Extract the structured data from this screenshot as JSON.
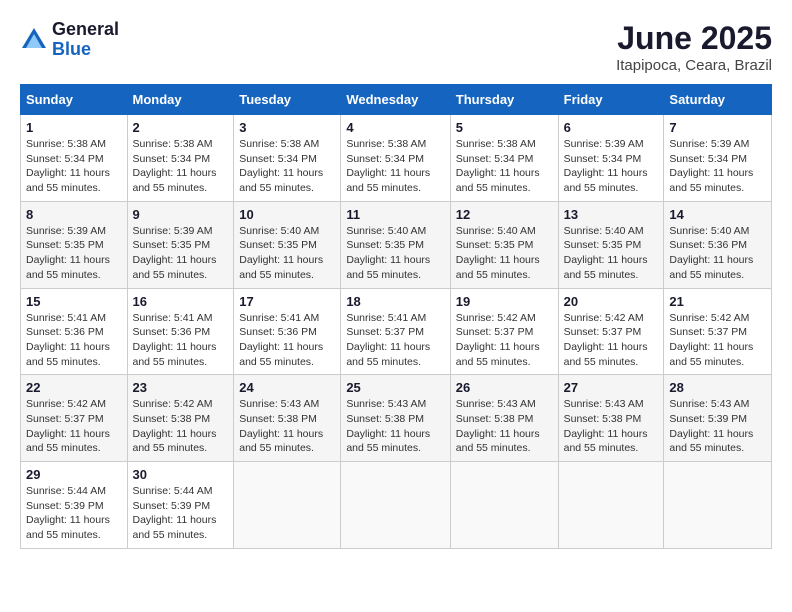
{
  "logo": {
    "general": "General",
    "blue": "Blue"
  },
  "header": {
    "month": "June 2025",
    "location": "Itapipoca, Ceara, Brazil"
  },
  "days_of_week": [
    "Sunday",
    "Monday",
    "Tuesday",
    "Wednesday",
    "Thursday",
    "Friday",
    "Saturday"
  ],
  "weeks": [
    [
      {
        "day": 1,
        "sunrise": "5:38 AM",
        "sunset": "5:34 PM",
        "daylight": "11 hours and 55 minutes."
      },
      {
        "day": 2,
        "sunrise": "5:38 AM",
        "sunset": "5:34 PM",
        "daylight": "11 hours and 55 minutes."
      },
      {
        "day": 3,
        "sunrise": "5:38 AM",
        "sunset": "5:34 PM",
        "daylight": "11 hours and 55 minutes."
      },
      {
        "day": 4,
        "sunrise": "5:38 AM",
        "sunset": "5:34 PM",
        "daylight": "11 hours and 55 minutes."
      },
      {
        "day": 5,
        "sunrise": "5:38 AM",
        "sunset": "5:34 PM",
        "daylight": "11 hours and 55 minutes."
      },
      {
        "day": 6,
        "sunrise": "5:39 AM",
        "sunset": "5:34 PM",
        "daylight": "11 hours and 55 minutes."
      },
      {
        "day": 7,
        "sunrise": "5:39 AM",
        "sunset": "5:34 PM",
        "daylight": "11 hours and 55 minutes."
      }
    ],
    [
      {
        "day": 8,
        "sunrise": "5:39 AM",
        "sunset": "5:35 PM",
        "daylight": "11 hours and 55 minutes."
      },
      {
        "day": 9,
        "sunrise": "5:39 AM",
        "sunset": "5:35 PM",
        "daylight": "11 hours and 55 minutes."
      },
      {
        "day": 10,
        "sunrise": "5:40 AM",
        "sunset": "5:35 PM",
        "daylight": "11 hours and 55 minutes."
      },
      {
        "day": 11,
        "sunrise": "5:40 AM",
        "sunset": "5:35 PM",
        "daylight": "11 hours and 55 minutes."
      },
      {
        "day": 12,
        "sunrise": "5:40 AM",
        "sunset": "5:35 PM",
        "daylight": "11 hours and 55 minutes."
      },
      {
        "day": 13,
        "sunrise": "5:40 AM",
        "sunset": "5:35 PM",
        "daylight": "11 hours and 55 minutes."
      },
      {
        "day": 14,
        "sunrise": "5:40 AM",
        "sunset": "5:36 PM",
        "daylight": "11 hours and 55 minutes."
      }
    ],
    [
      {
        "day": 15,
        "sunrise": "5:41 AM",
        "sunset": "5:36 PM",
        "daylight": "11 hours and 55 minutes."
      },
      {
        "day": 16,
        "sunrise": "5:41 AM",
        "sunset": "5:36 PM",
        "daylight": "11 hours and 55 minutes."
      },
      {
        "day": 17,
        "sunrise": "5:41 AM",
        "sunset": "5:36 PM",
        "daylight": "11 hours and 55 minutes."
      },
      {
        "day": 18,
        "sunrise": "5:41 AM",
        "sunset": "5:37 PM",
        "daylight": "11 hours and 55 minutes."
      },
      {
        "day": 19,
        "sunrise": "5:42 AM",
        "sunset": "5:37 PM",
        "daylight": "11 hours and 55 minutes."
      },
      {
        "day": 20,
        "sunrise": "5:42 AM",
        "sunset": "5:37 PM",
        "daylight": "11 hours and 55 minutes."
      },
      {
        "day": 21,
        "sunrise": "5:42 AM",
        "sunset": "5:37 PM",
        "daylight": "11 hours and 55 minutes."
      }
    ],
    [
      {
        "day": 22,
        "sunrise": "5:42 AM",
        "sunset": "5:37 PM",
        "daylight": "11 hours and 55 minutes."
      },
      {
        "day": 23,
        "sunrise": "5:42 AM",
        "sunset": "5:38 PM",
        "daylight": "11 hours and 55 minutes."
      },
      {
        "day": 24,
        "sunrise": "5:43 AM",
        "sunset": "5:38 PM",
        "daylight": "11 hours and 55 minutes."
      },
      {
        "day": 25,
        "sunrise": "5:43 AM",
        "sunset": "5:38 PM",
        "daylight": "11 hours and 55 minutes."
      },
      {
        "day": 26,
        "sunrise": "5:43 AM",
        "sunset": "5:38 PM",
        "daylight": "11 hours and 55 minutes."
      },
      {
        "day": 27,
        "sunrise": "5:43 AM",
        "sunset": "5:38 PM",
        "daylight": "11 hours and 55 minutes."
      },
      {
        "day": 28,
        "sunrise": "5:43 AM",
        "sunset": "5:39 PM",
        "daylight": "11 hours and 55 minutes."
      }
    ],
    [
      {
        "day": 29,
        "sunrise": "5:44 AM",
        "sunset": "5:39 PM",
        "daylight": "11 hours and 55 minutes."
      },
      {
        "day": 30,
        "sunrise": "5:44 AM",
        "sunset": "5:39 PM",
        "daylight": "11 hours and 55 minutes."
      },
      null,
      null,
      null,
      null,
      null
    ]
  ],
  "labels": {
    "sunrise": "Sunrise:",
    "sunset": "Sunset:",
    "daylight": "Daylight:"
  }
}
